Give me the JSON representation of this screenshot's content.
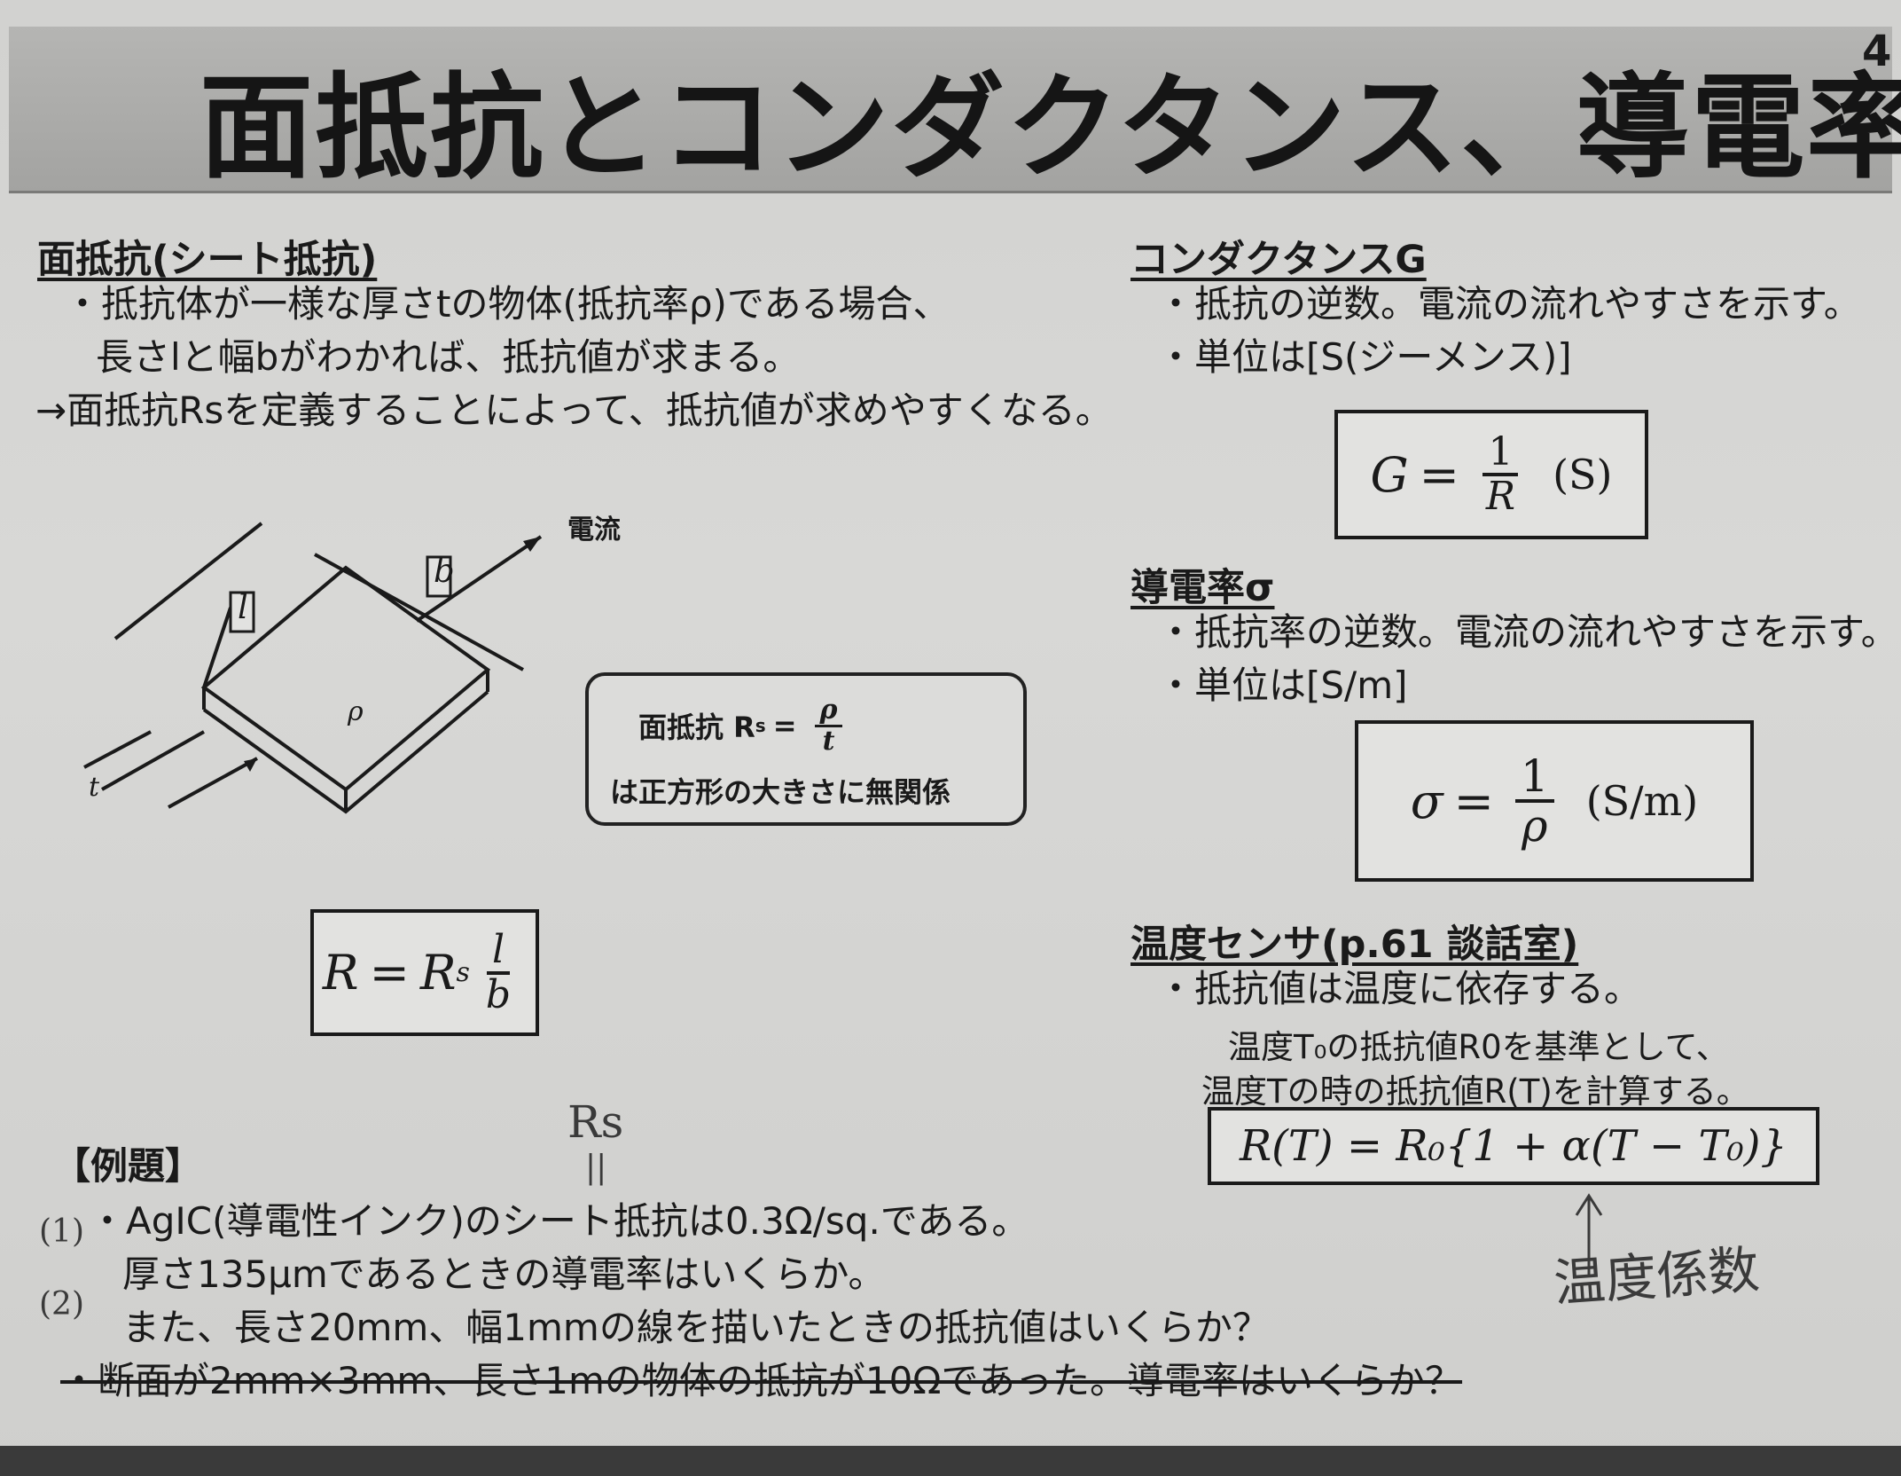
{
  "slide": {
    "title": "面抵抗とコンダクタンス、導電率",
    "page_number": "4"
  },
  "sheet_resistance": {
    "heading": "面抵抗(シート抵抗)",
    "line1": "・抵抗体が一様な厚さtの物体(抵抗率ρ)である場合、",
    "line2": "長さlと幅bがわかれば、抵抗値が求まる。",
    "line3": "→面抵抗Rsを定義することによって、抵抗値が求めやすくなる。",
    "diagram": {
      "current_label": "電流",
      "l_label": "l",
      "b_label": "b",
      "rho_label": "ρ",
      "t_label": "t"
    },
    "note_line1_prefix": "面抵抗 R",
    "note_line1_sub": "s",
    "note_line1_eq": "=",
    "note_num": "ρ",
    "note_den": "t",
    "note_line2": "は正方形の大きさに無関係",
    "formula_lhs": "R",
    "formula_eq": "=",
    "formula_rs": "R",
    "formula_rs_sub": "s",
    "formula_num": "l",
    "formula_den": "b"
  },
  "conductance": {
    "heading": "コンダクタンスG",
    "line1": "・抵抗の逆数。電流の流れやすさを示す。",
    "line2": "・単位は[S(ジーメンス)]",
    "formula_lhs": "G",
    "formula_eq": "=",
    "formula_num": "1",
    "formula_den": "R",
    "formula_unit": "(S)"
  },
  "conductivity": {
    "heading": "導電率σ",
    "line1": "・抵抗率の逆数。電流の流れやすさを示す。",
    "line2": "・単位は[S/m]",
    "formula_lhs": "σ",
    "formula_eq": "=",
    "formula_num": "1",
    "formula_den": "ρ",
    "formula_unit": "(S/m)"
  },
  "temperature_sensor": {
    "heading": "温度センサ(p.61 談話室)",
    "line1": "・抵抗値は温度に依存する。",
    "line2": "温度T₀の抵抗値R0を基準として、",
    "line3": "温度Tの時の抵抗値R(T)を計算する。",
    "formula": "R(T) = R₀{1 + α(T − T₀)}",
    "handwritten_note": "温度係数"
  },
  "example": {
    "heading": "【例題】",
    "q1": "・AgIC(導電性インク)のシート抵抗は0.3Ω/sq.である。",
    "q1b": "厚さ135μmであるときの導電率はいくらか。",
    "q2": "また、長さ20mm、幅1mmの線を描いたときの抵抗値はいくらか？",
    "q3_struck": "・断面が2mm×3mm、長さ1mの物体の抵抗が10Ωであった。導電率はいくらか？",
    "hand_mark_1": "(1)",
    "hand_mark_2": "(2)",
    "hand_rs": "Rs",
    "hand_eq": "||"
  },
  "colors": {
    "background": "#d4d4d2",
    "title_bar": "#a8a8a6",
    "text": "#1a1a1a"
  }
}
